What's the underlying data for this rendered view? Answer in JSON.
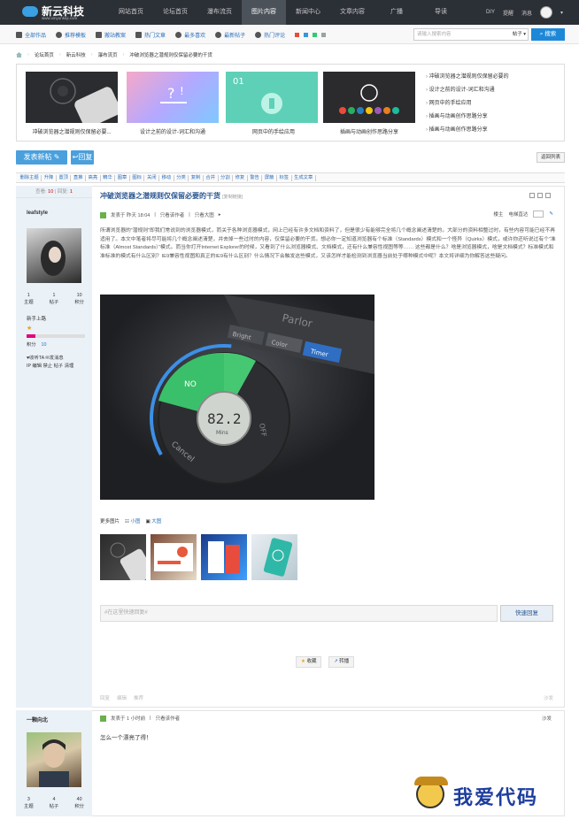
{
  "header": {
    "logo_title": "新云科技",
    "logo_sub": "www.xinyunkeji.com",
    "nav": [
      "网站首页",
      "论坛首页",
      "瀑布流页",
      "图片内容",
      "新闻中心",
      "文章内容",
      "广播",
      "导读"
    ],
    "active_nav": "图片内容",
    "right": [
      "DIY",
      "提醒",
      "消息"
    ]
  },
  "subnav": {
    "items": [
      {
        "label": "全部作品",
        "icon": "grid-icon",
        "color": "#3b6ea5"
      },
      {
        "label": "推荐模板",
        "icon": "bulb-icon",
        "color": "#555"
      },
      {
        "label": "搬站教案",
        "icon": "chef-icon",
        "color": "#555"
      },
      {
        "label": "热门文章",
        "icon": "doc-icon",
        "color": "#555"
      },
      {
        "label": "最多喜欢",
        "icon": "heart-icon",
        "color": "#555"
      },
      {
        "label": "最新帖子",
        "icon": "clock-icon",
        "color": "#555"
      },
      {
        "label": "热门评论",
        "icon": "comment-icon",
        "color": "#555"
      }
    ],
    "color_squares": [
      "#e74c3c",
      "#3498db",
      "#2ecc71",
      "#95a5a6"
    ],
    "search_placeholder": "请输入搜索内容",
    "search_type": "帖子",
    "search_button": "搜索"
  },
  "breadcrumb": [
    "论坛首页",
    "新云科技",
    "瀑布流页",
    "冲破浏览器之潜规则仅保留必要的干货"
  ],
  "slider": {
    "items": [
      {
        "caption": "冲破浏览器之潜规则仅保留必要...",
        "bg": "linear-gradient(135deg,#222,#444)"
      },
      {
        "caption": "设计之前的设计-词汇和沟通",
        "bg": "linear-gradient(135deg,#f6a8c8,#7fb7ff)"
      },
      {
        "caption": "网页中的手绘应用",
        "bg": "linear-gradient(135deg,#60d7c0,#b8f0e4)"
      },
      {
        "caption": "插画与动画创作思路分享",
        "bg": "linear-gradient(135deg,#222,#3a3a3a)"
      }
    ],
    "list": [
      "冲破浏览器之潜规则仅保留必要的",
      "设计之前的设计-词汇和沟通",
      "网页中的手绘应用",
      "插画与动画创作思路分享",
      "插画与动画创作思路分享"
    ]
  },
  "actions": {
    "post": "发表新帖",
    "reply": "回复",
    "back": "返回列表"
  },
  "modbar": [
    "删除主题",
    "升降",
    "置顶",
    "直推",
    "高亮",
    "精华",
    "图章",
    "图标",
    "关闭",
    "移动",
    "分类",
    "复制",
    "合并",
    "分割",
    "修复",
    "警告",
    "屏蔽",
    "标签",
    "生成文章"
  ],
  "post": {
    "views_label": "查看:",
    "views": "10",
    "replies_label": "回复:",
    "replies": "1",
    "author": "leafstyle",
    "stats": [
      {
        "v": "1",
        "l": "主题"
      },
      {
        "v": "1",
        "l": "帖子"
      },
      {
        "v": "10",
        "l": "积分"
      }
    ],
    "rank": "新手上路",
    "points_label": "积分",
    "points": "10",
    "user_links": [
      "收听TA",
      "发消息",
      "IP",
      "编辑",
      "禁止",
      "帖子",
      "清理"
    ],
    "title": "冲破浏览器之潜规则仅保留必要的干货",
    "copy_link": "[复制链接]",
    "meta": {
      "posted": "发表于 昨天 18:04",
      "only_author": "只看该作者",
      "big_image": "只看大图",
      "floor": "楼主",
      "mobile": "电梯直达"
    },
    "body": "所谓浏览器的“潜规则”即我们常说到的浏览器模式，而关于各种浏览器模式，网上已经有许多文档和资料了，但是很少有能够完全将几个概念阐述清楚的。大部分的资料相整过时，有些内容可能已经不再适用了。本文中笔者将尽可能将几个概念阐述清楚，并去掉一些过时的内容，仅保留必要的干货。想必你一定知道浏览器有个标准（Standards）模式和一个怪异（Quirks）模式，或许你还听说过有个“准标准（Almost Standards）”模式。而当你打开Internet Explorer的时候，又看到了什么浏览器模式、文档模式，还有什么兼容性视图等等…… 这些都是什么？啥是浏览器模式，啥是文档模式？标准模式和准标准的模式有什么区别？IE9兼容性视图和真正的IE9有什么区别？什么情况下会触发这些模式，又该怎样才能检测到浏览器当前处于哪种模式中呢？本文将详细为你解答这些疑问。",
    "image_labels": {
      "brand": "Parlor",
      "tab1": "Bright",
      "tab2": "Color",
      "tab3": "Timer",
      "no": "NO",
      "off": "OFF",
      "cancel": "Cancel",
      "value": "82.2",
      "unit": "Mins"
    },
    "more_images": "更多图片",
    "small_label": "小图",
    "large_label": "大图",
    "thumbs": [
      "linear-gradient(135deg,#2b2b2b,#555)",
      "linear-gradient(135deg,#7a4a35,#e8dcc8)",
      "linear-gradient(135deg,#1a3a8a,#3fa0ff)",
      "linear-gradient(135deg,#e8eef2,#2fb8a8)"
    ],
    "reply_placeholder": "#在这里快速回复#",
    "reply_button": "快速回复",
    "favorite": "收藏",
    "share": "转播",
    "footer": [
      "回复",
      "编辑",
      "推荐"
    ],
    "floor_num": "沙发"
  },
  "reply": {
    "author": "一颗向北",
    "stats": [
      {
        "v": "3",
        "l": "主题"
      },
      {
        "v": "4",
        "l": "帖子"
      },
      {
        "v": "40",
        "l": "积分"
      }
    ],
    "posted": "发表于 1 小时前",
    "only_author": "只看该作者",
    "floor": "沙发",
    "text": "怎么一个漂亮了得！"
  },
  "watermark": "我爱代码"
}
